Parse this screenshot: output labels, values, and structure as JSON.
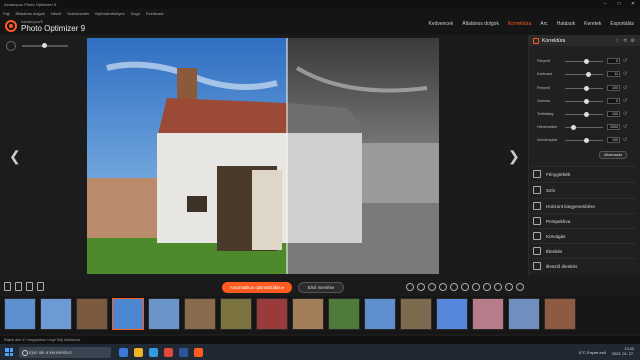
{
  "window": {
    "title": "Ashampoo Photo Optimizer 9"
  },
  "menu": [
    "Fájl",
    "Általános dolgok",
    "Nézet",
    "Szerkesztés",
    "Mythodrarhelyes",
    "Súgó",
    "Feedback"
  ],
  "brand": {
    "small": "Ashampoo®",
    "name": "Photo Optimizer 9"
  },
  "tabs": [
    {
      "label": "Kedvencek",
      "active": false
    },
    {
      "label": "Általános dolgok",
      "active": false
    },
    {
      "label": "Korrektúra",
      "active": true
    },
    {
      "label": "Arc",
      "active": false
    },
    {
      "label": "Hatások",
      "active": false
    },
    {
      "label": "Keretek",
      "active": false
    },
    {
      "label": "Exportálás",
      "active": false
    }
  ],
  "panel": {
    "title": "Korrektúra",
    "header_buttons": "☆ ⟲ ⚙",
    "sliders": [
      {
        "label": "Fényerő",
        "value": "0",
        "pos": 0.5
      },
      {
        "label": "Kontraszt",
        "value": "11",
        "pos": 0.56
      },
      {
        "label": "Fényerő",
        "value": "100",
        "pos": 0.5
      },
      {
        "label": "Gamma",
        "value": "0",
        "pos": 0.5
      },
      {
        "label": "Telítettség",
        "value": "100",
        "pos": 0.5
      },
      {
        "label": "Hőmérséklet",
        "value": "2500",
        "pos": 0.2
      },
      {
        "label": "Színárnyalat",
        "value": "100",
        "pos": 0.5
      }
    ],
    "apply": "Alkalmazás",
    "tools": [
      "Fénygörbék",
      "Szín",
      "Horizont kiegyenesítése",
      "Perspektíva",
      "Körvágás",
      "Élesítés",
      "Illesztő élesítés"
    ]
  },
  "actions": {
    "auto": "Automatikus optimalizálás ▸",
    "reset": "Első mentése"
  },
  "status": "Rajtok ább 47 megaakkos f rege Sájt kivilasztva",
  "taskbar": {
    "search": "Írjon ide a kereséshez",
    "weather": "6°C Enyhe eső",
    "time": "13:40",
    "date": "2023. 01. 27."
  },
  "colors": {
    "accent": "#ff5a1f"
  }
}
